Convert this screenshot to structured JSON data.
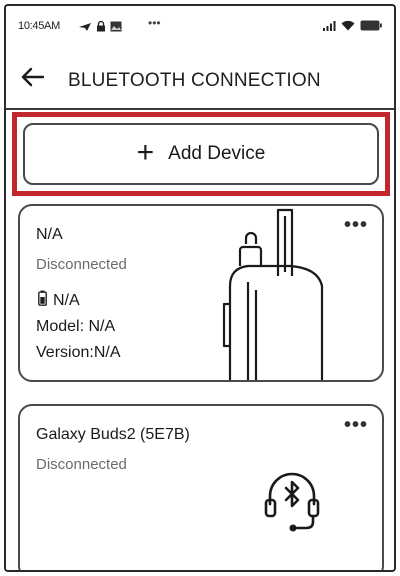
{
  "status_bar": {
    "time": "10:45AM",
    "overflow": "•••",
    "icons": [
      "navigation-icon",
      "lock-icon",
      "image-icon",
      "signal-icon",
      "wifi-icon",
      "battery-icon"
    ]
  },
  "header": {
    "title": "BLUETOOTH CONNECTION",
    "back_icon": "back-arrow-icon"
  },
  "add_device": {
    "plus": "+",
    "label": "Add Device",
    "highlight_color": "#c1272d"
  },
  "devices": [
    {
      "name": "N/A",
      "status": "Disconnected",
      "battery": "N/A",
      "model": "Model: N/A",
      "version": "Version:N/A",
      "menu": "•••",
      "image": "two-way-radio"
    },
    {
      "name": "Galaxy Buds2 (5E7B)",
      "status": "Disconnected",
      "menu": "•••",
      "image": "bluetooth-headset-icon"
    }
  ]
}
